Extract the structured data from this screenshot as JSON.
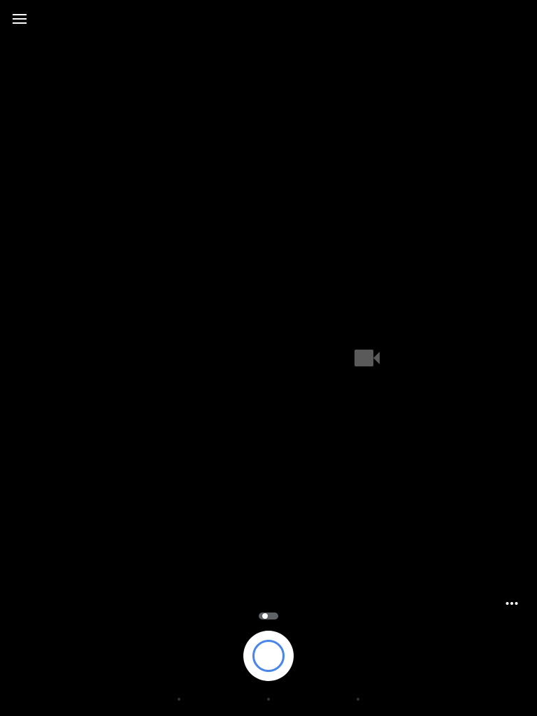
{
  "app": {
    "background_color": "#000000"
  },
  "top_bar": {
    "menu_icon": "hamburger-menu-icon"
  },
  "viewfinder": {
    "mode_icon": "video-camera-icon",
    "mode_icon_color": "#5a5a5a"
  },
  "controls": {
    "overflow_icon": "more-horizontal-icon",
    "camera_switch_icon": "camera-switch-toggle",
    "camera_switch_state": "off",
    "shutter_icon": "shutter-icon",
    "shutter_accent_color": "#4a86e8"
  },
  "mode_indicators": {
    "count": 3,
    "selected_index": 1,
    "color": "#333333"
  }
}
